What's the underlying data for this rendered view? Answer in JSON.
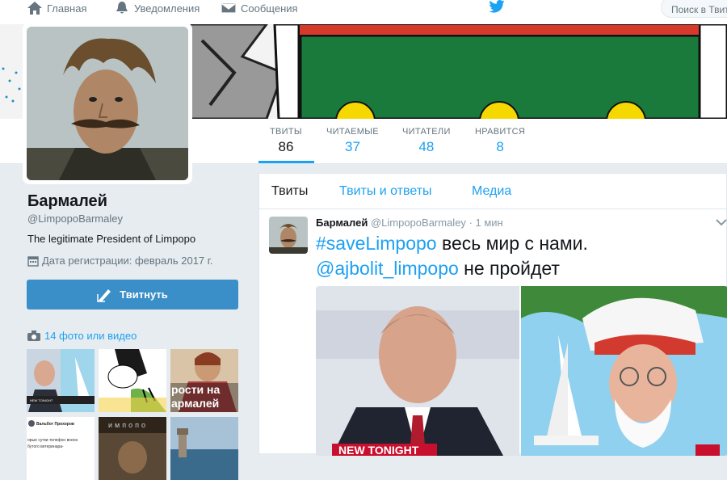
{
  "nav": {
    "home_label": "Главная",
    "notifications_label": "Уведомления",
    "messages_label": "Сообщения",
    "search_placeholder": "Поиск в Твит"
  },
  "profile": {
    "name": "Бармалей",
    "handle": "@LimpopoBarmaley",
    "bio": "The legitimate President of Limpopo",
    "joined": "Дата регистрации: февраль 2017 г.",
    "tweet_button": "Твитнуть",
    "photos_link": "14 фото или видео"
  },
  "stats": [
    {
      "label": "ТВИТЫ",
      "value": "86"
    },
    {
      "label": "ЧИТАЕМЫЕ",
      "value": "37"
    },
    {
      "label": "ЧИТАТЕЛИ",
      "value": "48"
    },
    {
      "label": "НРАВИТСЯ",
      "value": "8"
    }
  ],
  "tabs": [
    "Твиты",
    "Твиты и ответы",
    "Медиа"
  ],
  "tweet": {
    "author": "Бармалей",
    "handle": "@LimpopoBarmaley",
    "time": "· 1 мин",
    "hashtag": "#saveLimpopo",
    "text1": " весь мир с нами.",
    "mention": "@ajbolit_limpopo",
    "text2": " не пройдет",
    "media_caption": "NEW TONIGHT"
  },
  "thumbnails": {
    "t3_text": "рости на\nармалей",
    "t4_text": "Вальбот Прохоров",
    "t4_sub": "орые сутки телефон военн\nбутого ветеринара-",
    "t5_text": "импопо"
  },
  "colors": {
    "accent": "#1da1f2",
    "button": "#3a8fc8",
    "banner_green": "#1a7a3c",
    "banner_yellow": "#f5d800"
  }
}
